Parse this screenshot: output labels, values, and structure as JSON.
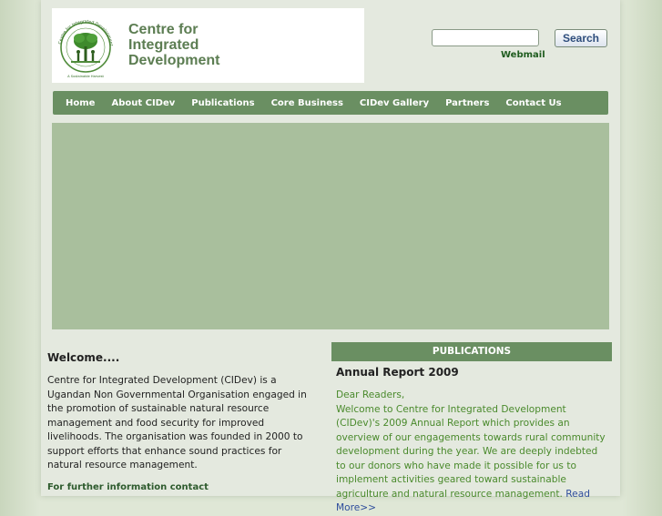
{
  "header": {
    "logo": {
      "line1": "Centre for",
      "line2": "Integrated",
      "line3": "Development",
      "emblem_ring_text": "Centre for Integrated Development",
      "emblem_tagline": "A Sustainable Harvest"
    },
    "search": {
      "value": "",
      "button_label": "Search"
    },
    "webmail_label": "Webmail"
  },
  "nav": {
    "items": [
      {
        "label": "Home"
      },
      {
        "label": "About CIDev"
      },
      {
        "label": "Publications"
      },
      {
        "label": "Core Business"
      },
      {
        "label": "CIDev Gallery"
      },
      {
        "label": "Partners"
      },
      {
        "label": "Contact Us"
      }
    ]
  },
  "welcome": {
    "title": "Welcome....",
    "text": "Centre for Integrated Development (CIDev) is a Ugandan Non Governmental Organisation engaged in the promotion of sustainable natural resource management and food security for improved livelihoods. The organisation was founded in 2000 to support efforts that enhance sound practices for natural resource management.",
    "contact_label": "For further information contact"
  },
  "publications": {
    "header": "PUBLICATIONS",
    "title": "Annual Report 2009",
    "greeting": "Dear Readers,",
    "body": "Welcome to Centre for Integrated Development (CIDev)'s 2009 Annual Report which provides an overview of our engagements towards rural community development during the year. We are deeply indebted to our donors who have made it possible for us to implement activities geared toward sustainable agriculture and natural resource management.",
    "read_more": "Read More>>"
  },
  "colors": {
    "nav_bg": "#6a8f62",
    "banner_bg": "#a9bf9d",
    "brand_text": "#5c7d52",
    "link_green": "#4a8a2c"
  }
}
